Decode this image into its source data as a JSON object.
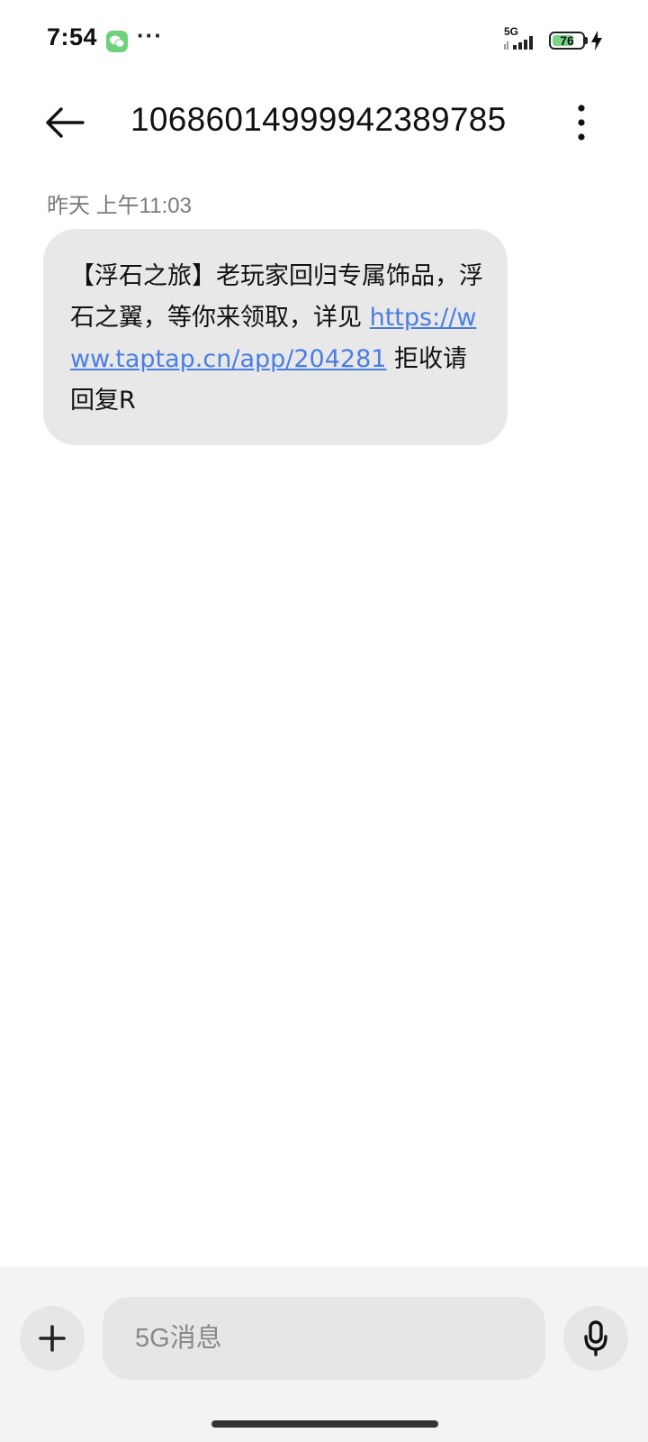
{
  "status_bar": {
    "time": "7:54",
    "more": "···",
    "network": "5G",
    "battery_percent": "76",
    "battery_level": 0.76,
    "icons": [
      "wechat-icon",
      "signal-icon",
      "battery-icon",
      "charging-icon"
    ]
  },
  "header": {
    "back_icon": "arrow-left-icon",
    "title": "10686014999942389785",
    "menu_icon": "more-vertical-icon"
  },
  "conversation": {
    "timestamp": "昨天 上午11:03",
    "message": {
      "text_before": "【浮石之旅】老玩家回归专属饰品，浮石之翼，等你来领取，详见 ",
      "link": "https://www.taptap.cn/app/204281",
      "text_after": " 拒收请回复R"
    }
  },
  "composer": {
    "add_icon": "plus-icon",
    "placeholder": "5G消息",
    "value": "",
    "mic_icon": "microphone-icon"
  },
  "colors": {
    "bubble": "#e8e8e8",
    "link": "#4a7ee3",
    "composer_bg": "#f3f3f3",
    "battery_fill": "#7bd389",
    "wechat": "#6fd17a"
  }
}
